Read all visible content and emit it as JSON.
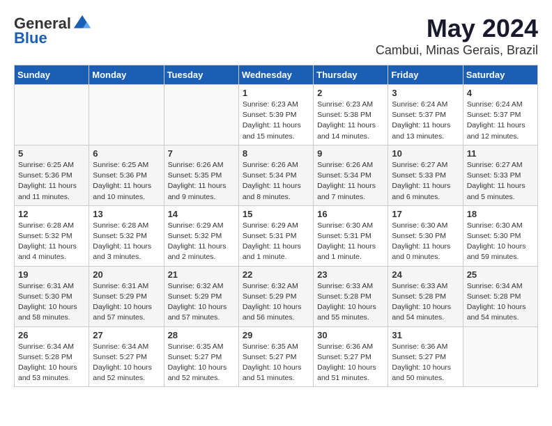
{
  "header": {
    "logo_general": "General",
    "logo_blue": "Blue",
    "month": "May 2024",
    "location": "Cambui, Minas Gerais, Brazil"
  },
  "days_of_week": [
    "Sunday",
    "Monday",
    "Tuesday",
    "Wednesday",
    "Thursday",
    "Friday",
    "Saturday"
  ],
  "weeks": [
    [
      {
        "day": "",
        "info": ""
      },
      {
        "day": "",
        "info": ""
      },
      {
        "day": "",
        "info": ""
      },
      {
        "day": "1",
        "info": "Sunrise: 6:23 AM\nSunset: 5:39 PM\nDaylight: 11 hours\nand 15 minutes."
      },
      {
        "day": "2",
        "info": "Sunrise: 6:23 AM\nSunset: 5:38 PM\nDaylight: 11 hours\nand 14 minutes."
      },
      {
        "day": "3",
        "info": "Sunrise: 6:24 AM\nSunset: 5:37 PM\nDaylight: 11 hours\nand 13 minutes."
      },
      {
        "day": "4",
        "info": "Sunrise: 6:24 AM\nSunset: 5:37 PM\nDaylight: 11 hours\nand 12 minutes."
      }
    ],
    [
      {
        "day": "5",
        "info": "Sunrise: 6:25 AM\nSunset: 5:36 PM\nDaylight: 11 hours\nand 11 minutes."
      },
      {
        "day": "6",
        "info": "Sunrise: 6:25 AM\nSunset: 5:36 PM\nDaylight: 11 hours\nand 10 minutes."
      },
      {
        "day": "7",
        "info": "Sunrise: 6:26 AM\nSunset: 5:35 PM\nDaylight: 11 hours\nand 9 minutes."
      },
      {
        "day": "8",
        "info": "Sunrise: 6:26 AM\nSunset: 5:34 PM\nDaylight: 11 hours\nand 8 minutes."
      },
      {
        "day": "9",
        "info": "Sunrise: 6:26 AM\nSunset: 5:34 PM\nDaylight: 11 hours\nand 7 minutes."
      },
      {
        "day": "10",
        "info": "Sunrise: 6:27 AM\nSunset: 5:33 PM\nDaylight: 11 hours\nand 6 minutes."
      },
      {
        "day": "11",
        "info": "Sunrise: 6:27 AM\nSunset: 5:33 PM\nDaylight: 11 hours\nand 5 minutes."
      }
    ],
    [
      {
        "day": "12",
        "info": "Sunrise: 6:28 AM\nSunset: 5:32 PM\nDaylight: 11 hours\nand 4 minutes."
      },
      {
        "day": "13",
        "info": "Sunrise: 6:28 AM\nSunset: 5:32 PM\nDaylight: 11 hours\nand 3 minutes."
      },
      {
        "day": "14",
        "info": "Sunrise: 6:29 AM\nSunset: 5:32 PM\nDaylight: 11 hours\nand 2 minutes."
      },
      {
        "day": "15",
        "info": "Sunrise: 6:29 AM\nSunset: 5:31 PM\nDaylight: 11 hours\nand 1 minute."
      },
      {
        "day": "16",
        "info": "Sunrise: 6:30 AM\nSunset: 5:31 PM\nDaylight: 11 hours\nand 1 minute."
      },
      {
        "day": "17",
        "info": "Sunrise: 6:30 AM\nSunset: 5:30 PM\nDaylight: 11 hours\nand 0 minutes."
      },
      {
        "day": "18",
        "info": "Sunrise: 6:30 AM\nSunset: 5:30 PM\nDaylight: 10 hours\nand 59 minutes."
      }
    ],
    [
      {
        "day": "19",
        "info": "Sunrise: 6:31 AM\nSunset: 5:30 PM\nDaylight: 10 hours\nand 58 minutes."
      },
      {
        "day": "20",
        "info": "Sunrise: 6:31 AM\nSunset: 5:29 PM\nDaylight: 10 hours\nand 57 minutes."
      },
      {
        "day": "21",
        "info": "Sunrise: 6:32 AM\nSunset: 5:29 PM\nDaylight: 10 hours\nand 57 minutes."
      },
      {
        "day": "22",
        "info": "Sunrise: 6:32 AM\nSunset: 5:29 PM\nDaylight: 10 hours\nand 56 minutes."
      },
      {
        "day": "23",
        "info": "Sunrise: 6:33 AM\nSunset: 5:28 PM\nDaylight: 10 hours\nand 55 minutes."
      },
      {
        "day": "24",
        "info": "Sunrise: 6:33 AM\nSunset: 5:28 PM\nDaylight: 10 hours\nand 54 minutes."
      },
      {
        "day": "25",
        "info": "Sunrise: 6:34 AM\nSunset: 5:28 PM\nDaylight: 10 hours\nand 54 minutes."
      }
    ],
    [
      {
        "day": "26",
        "info": "Sunrise: 6:34 AM\nSunset: 5:28 PM\nDaylight: 10 hours\nand 53 minutes."
      },
      {
        "day": "27",
        "info": "Sunrise: 6:34 AM\nSunset: 5:27 PM\nDaylight: 10 hours\nand 52 minutes."
      },
      {
        "day": "28",
        "info": "Sunrise: 6:35 AM\nSunset: 5:27 PM\nDaylight: 10 hours\nand 52 minutes."
      },
      {
        "day": "29",
        "info": "Sunrise: 6:35 AM\nSunset: 5:27 PM\nDaylight: 10 hours\nand 51 minutes."
      },
      {
        "day": "30",
        "info": "Sunrise: 6:36 AM\nSunset: 5:27 PM\nDaylight: 10 hours\nand 51 minutes."
      },
      {
        "day": "31",
        "info": "Sunrise: 6:36 AM\nSunset: 5:27 PM\nDaylight: 10 hours\nand 50 minutes."
      },
      {
        "day": "",
        "info": ""
      }
    ]
  ]
}
